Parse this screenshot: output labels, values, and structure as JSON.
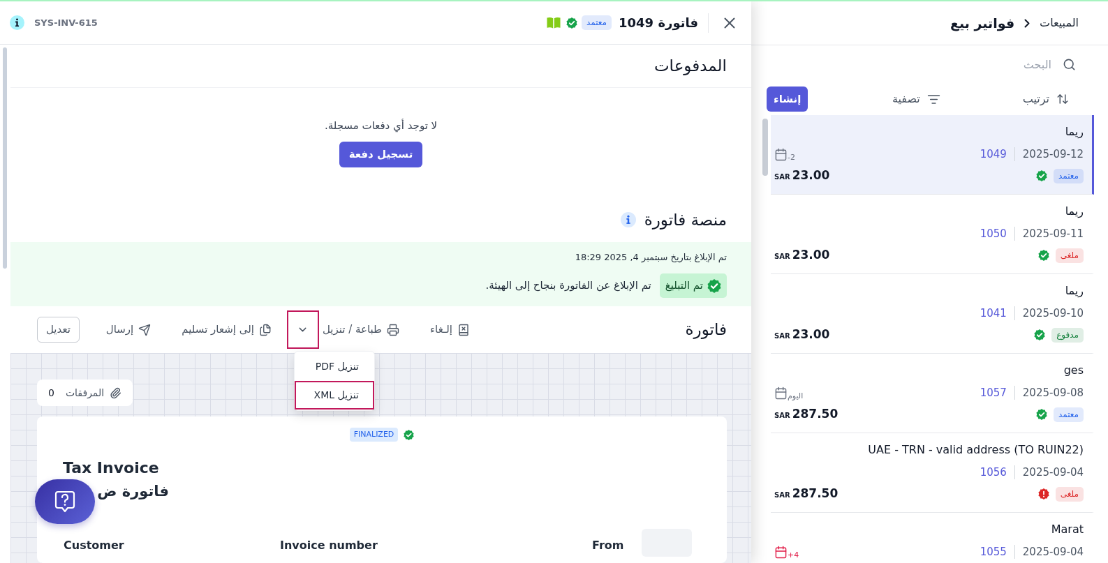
{
  "invoice_list": {
    "breadcrumb": [
      {
        "label": "المبيعات",
        "current": false
      },
      {
        "label": "فواتير بيع",
        "current": true
      }
    ],
    "search": {
      "placeholder": "البحث"
    },
    "toolbar": {
      "sort": "ترتيب",
      "filter": "تصفية",
      "create": "إنشاء"
    },
    "items": [
      {
        "name": "ريما",
        "date": "2025-09-12",
        "number": "1049",
        "due": {
          "label": "-2",
          "alert": false
        },
        "status": {
          "label": "معتمد",
          "color": "#2563eb"
        },
        "check": {
          "kind": "verified"
        },
        "amount": {
          "currency": "SAR",
          "value": "23.00"
        },
        "selected": true
      },
      {
        "name": "ريما",
        "date": "2025-09-11",
        "number": "1050",
        "status": {
          "label": "ملغى",
          "color": "#dc2626"
        },
        "check": {
          "kind": "verified"
        },
        "amount": {
          "currency": "SAR",
          "value": "23.00"
        },
        "selected": false
      },
      {
        "name": "ريما",
        "date": "2025-09-10",
        "number": "1041",
        "status": {
          "label": "مدفوع",
          "color": "#15803d"
        },
        "check": {
          "kind": "verified"
        },
        "amount": {
          "currency": "SAR",
          "value": "23.00"
        },
        "selected": false
      },
      {
        "name": "ges",
        "date": "2025-09-08",
        "number": "1057",
        "due": {
          "label": "اليوم",
          "alert": false
        },
        "status": {
          "label": "معتمد",
          "color": "#2563eb"
        },
        "check": {
          "kind": "verified"
        },
        "amount": {
          "currency": "SAR",
          "value": "287.50"
        },
        "selected": false
      },
      {
        "name": "UAE - TRN - valid address (TO RUIN22)",
        "date": "2025-09-04",
        "number": "1056",
        "status": {
          "label": "ملغى",
          "color": "#dc2626"
        },
        "check": {
          "kind": "alert"
        },
        "amount": {
          "currency": "SAR",
          "value": "287.50"
        },
        "selected": false
      },
      {
        "name": "Marat",
        "date": "2025-09-04",
        "number": "1055",
        "due": {
          "label": "+4",
          "alert": true
        },
        "selected": false
      }
    ]
  },
  "invoice_panel": {
    "header": {
      "title": "فاتورة 1049",
      "status": {
        "label": "معتمد",
        "color": "#2563eb"
      },
      "check": {
        "kind": "verified"
      },
      "reference": "SYS-INV-615"
    },
    "payments": {
      "title": "المدفوعات",
      "empty_text": "لا توجد أي دفعات مسجلة.",
      "button": "تسجيل دفعة"
    },
    "platform": {
      "title": "منصة فاتورة",
      "reported_at": "تم الإبلاغ بتاريخ سبتمبر 4, 2025 18:29",
      "badge": "تم التبليغ",
      "message": "تم الإبلاغ عن الفاتورة بنجاح إلى الهيئة."
    },
    "document": {
      "title": "فاتورة",
      "actions": [
        {
          "kind": "action",
          "label": "إلـغاء",
          "highlighted": false
        },
        {
          "kind": "action",
          "label": "طباعة / تنزيل",
          "highlighted": false
        },
        {
          "kind": "caret",
          "highlighted": true,
          "expanded": true,
          "menu": [
            {
              "label": "تنزيل PDF",
              "highlighted": false
            },
            {
              "label": "تنزيل XML",
              "highlighted": true
            }
          ]
        },
        {
          "kind": "action",
          "label": "إلى إشعار تسليم",
          "highlighted": false
        },
        {
          "kind": "action",
          "label": "إرسال",
          "highlighted": false
        },
        {
          "kind": "outline",
          "label": "تعديل",
          "highlighted": false
        }
      ],
      "attachments": {
        "label": "المرفقات",
        "count": "0"
      },
      "preview": {
        "status": "FINALIZED",
        "check": {
          "kind": "verified"
        },
        "title": "Tax Invoice",
        "title_ar": "فاتورة ض",
        "columns": [
          "From",
          "Invoice number",
          "Customer"
        ]
      }
    }
  }
}
